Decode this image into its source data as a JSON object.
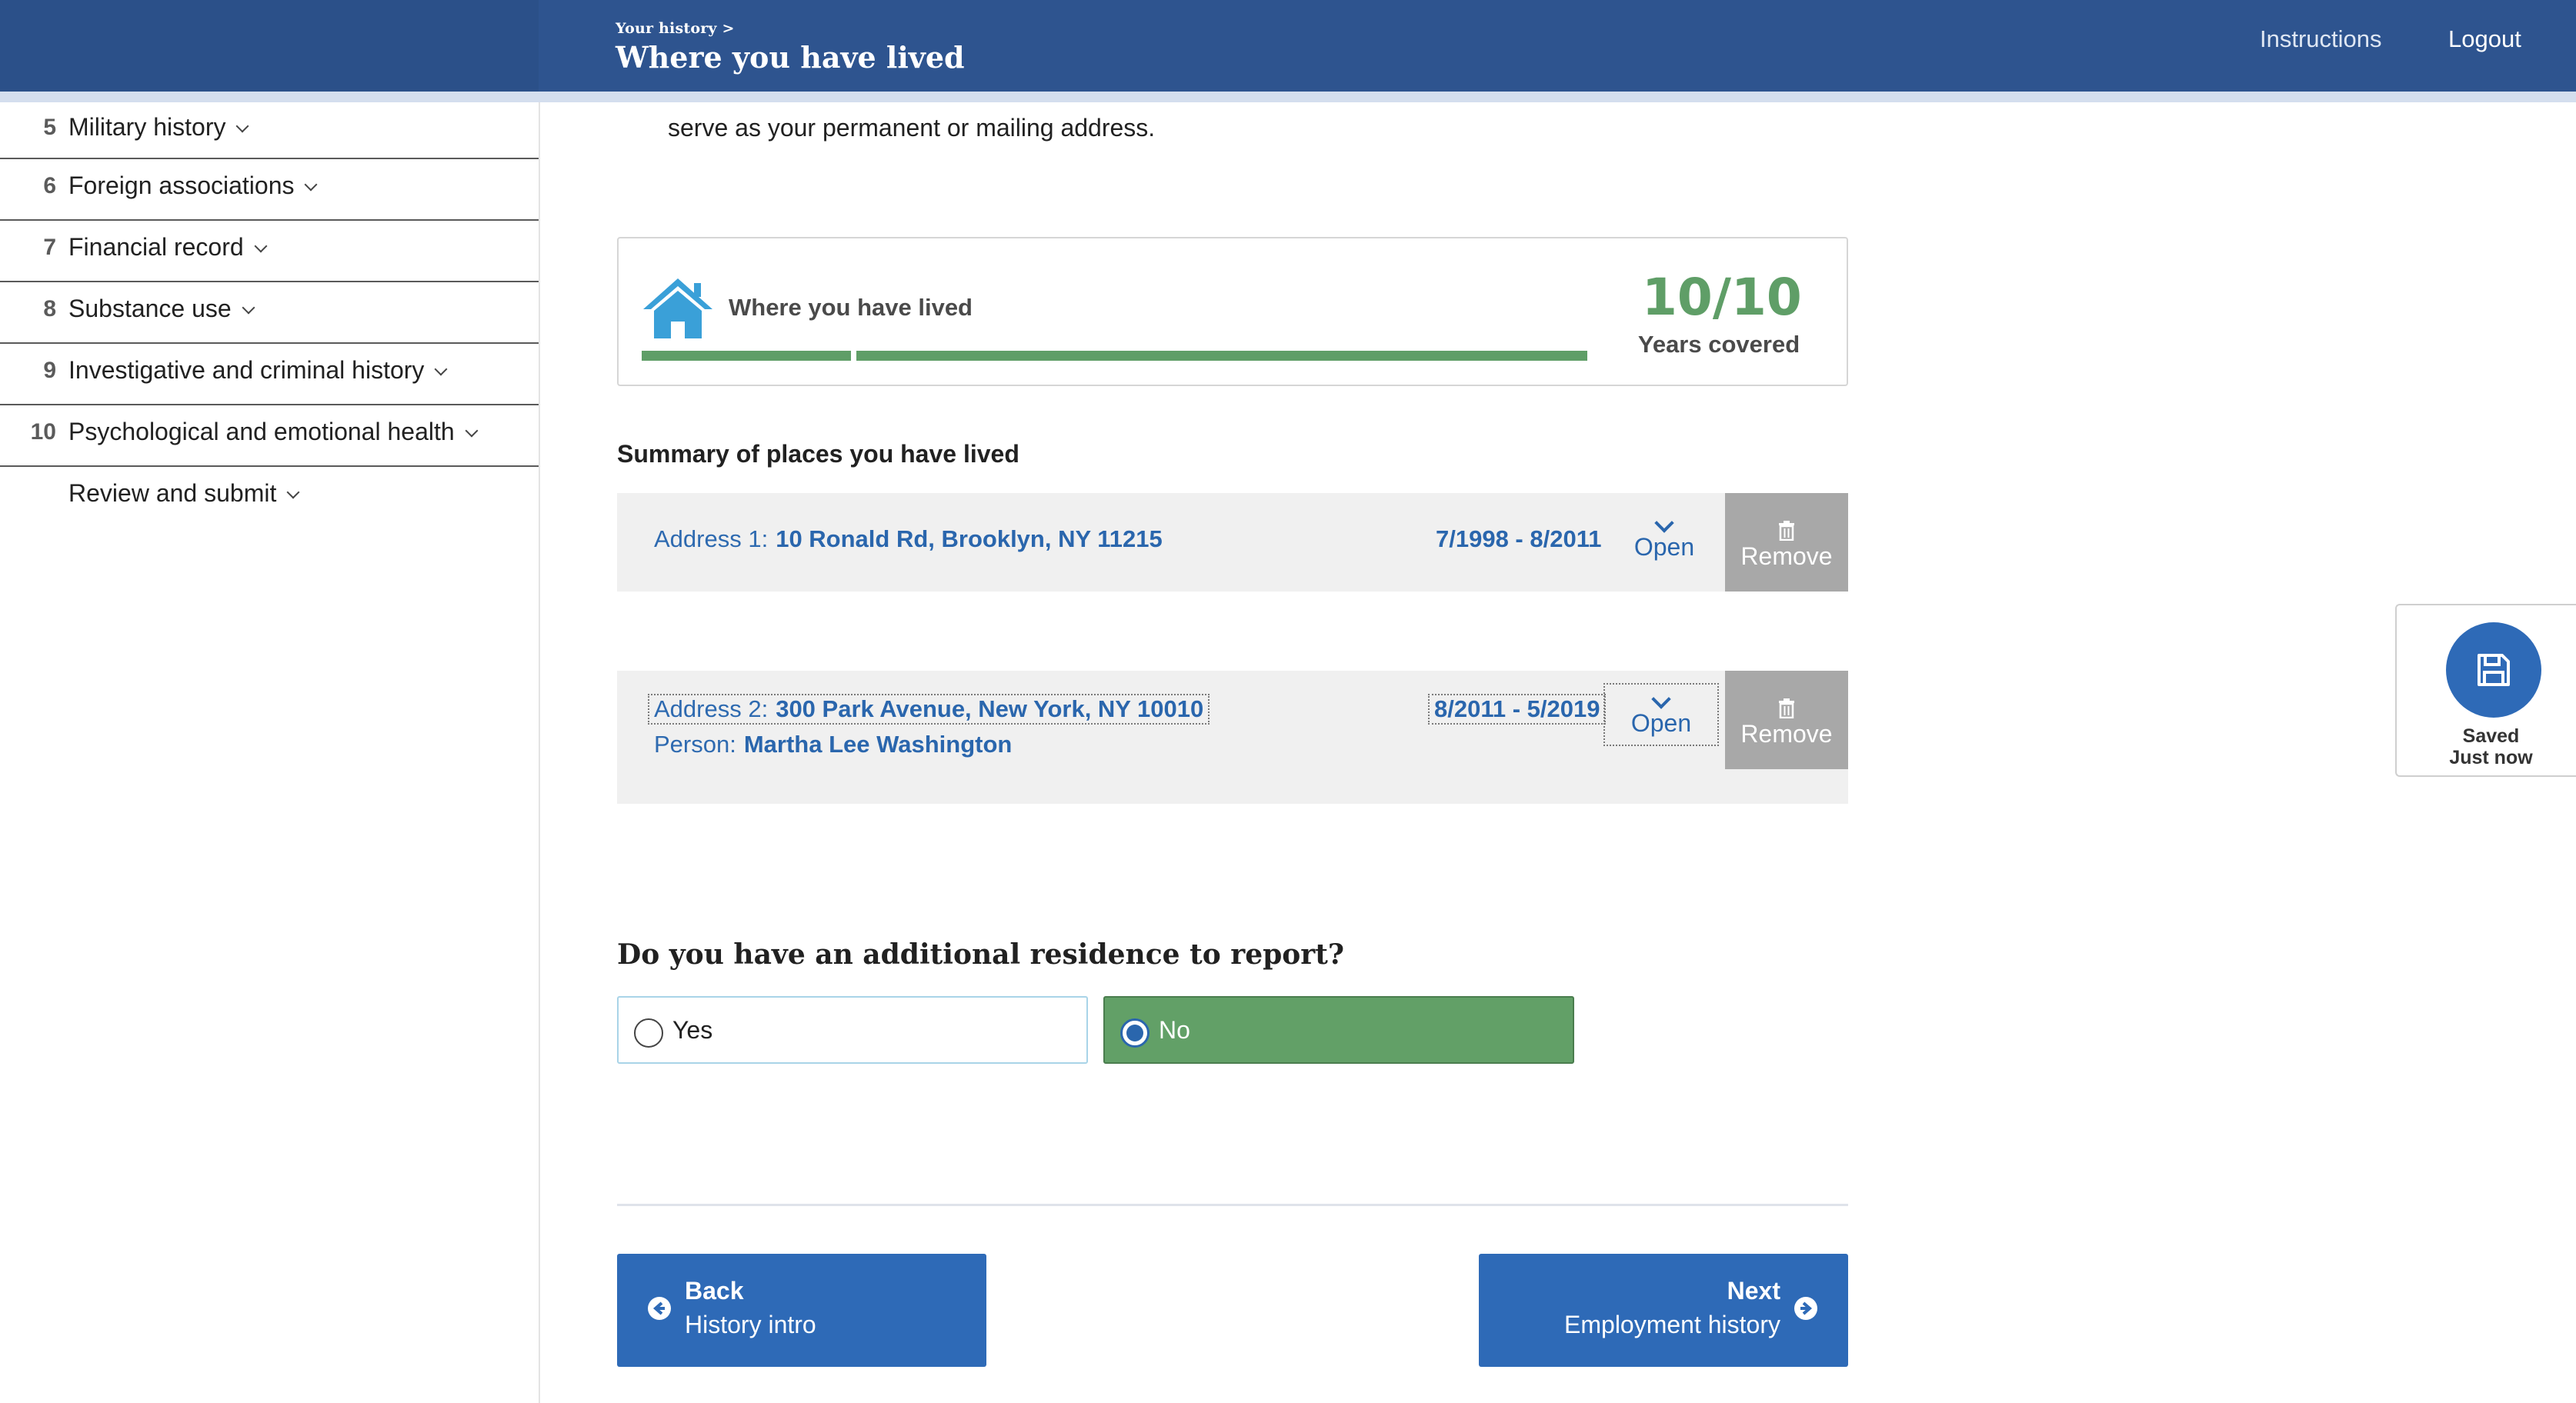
{
  "header": {
    "breadcrumb": "Your history >",
    "title": "Where you have lived",
    "instructions": "Instructions",
    "logout": "Logout"
  },
  "sidebar": {
    "items": [
      {
        "num": "5",
        "label": "Military history"
      },
      {
        "num": "6",
        "label": "Foreign associations"
      },
      {
        "num": "7",
        "label": "Financial record"
      },
      {
        "num": "8",
        "label": "Substance use"
      },
      {
        "num": "9",
        "label": "Investigative and criminal history"
      },
      {
        "num": "10",
        "label": "Psychological and emotional health"
      },
      {
        "num": "",
        "label": "Review and submit"
      }
    ]
  },
  "intro_text": "serve as your permanent or mailing address.",
  "progress": {
    "label": "Where you have lived",
    "years": "10/10",
    "years_label": "Years covered",
    "fill_fraction": 1.0,
    "accent_color": "#5f9e67"
  },
  "summary": {
    "title": "Summary of places you have lived",
    "addresses": [
      {
        "prefix": "Address 1:",
        "address": "10 Ronald Rd, Brooklyn, NY 11215",
        "dates": "7/1998 - 8/2011",
        "open": "Open",
        "remove": "Remove"
      },
      {
        "prefix": "Address 2:",
        "address": "300 Park Avenue, New York, NY 10010",
        "person_prefix": "Person:",
        "person": "Martha Lee Washington",
        "dates": "8/2011 - 5/2019",
        "open": "Open",
        "remove": "Remove"
      }
    ]
  },
  "question": {
    "text": "Do you have an additional residence to report?",
    "options": [
      {
        "label": "Yes",
        "selected": false
      },
      {
        "label": "No",
        "selected": true
      }
    ]
  },
  "navigation": {
    "back": {
      "label": "Back",
      "sub": "History intro"
    },
    "next": {
      "label": "Next",
      "sub": "Employment history"
    }
  },
  "saved": {
    "line1": "Saved",
    "line2": "Just now"
  }
}
